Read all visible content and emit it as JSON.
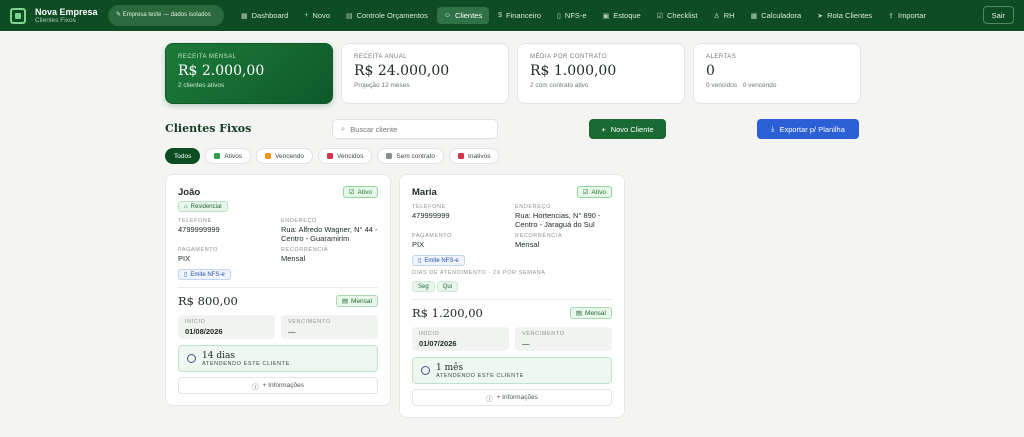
{
  "brand": {
    "name": "Nova Empresa",
    "sub": "Clientes Fixos"
  },
  "test_pill": "Empresa teste — dados isolados",
  "nav": [
    {
      "label": "Dashboard",
      "icon": "▦",
      "active": false
    },
    {
      "label": "Novo",
      "icon": "+",
      "active": false
    },
    {
      "label": "Controle Orçamentos",
      "icon": "▤",
      "active": false
    },
    {
      "label": "Clientes",
      "icon": "☺",
      "active": true
    },
    {
      "label": "Financeiro",
      "icon": "$",
      "active": false
    },
    {
      "label": "NFS-e",
      "icon": "▯",
      "active": false
    },
    {
      "label": "Estoque",
      "icon": "▣",
      "active": false
    },
    {
      "label": "Checklist",
      "icon": "☑",
      "active": false
    },
    {
      "label": "RH",
      "icon": "♙",
      "active": false
    },
    {
      "label": "Calculadora",
      "icon": "▦",
      "active": false
    },
    {
      "label": "Rota Clientes",
      "icon": "➤",
      "active": false
    },
    {
      "label": "Importar",
      "icon": "⇪",
      "active": false
    }
  ],
  "logout_label": "Sair",
  "stats": [
    {
      "label": "RECEITA MENSAL",
      "value": "R$ 2.000,00",
      "sub": "2 clientes ativos"
    },
    {
      "label": "RECEITA ANUAL",
      "value": "R$ 24.000,00",
      "sub": "Projeção 12 meses"
    },
    {
      "label": "MÉDIA POR CONTRATO",
      "value": "R$ 1.000,00",
      "sub": "2 com contrato ativo"
    },
    {
      "label": "ALERTAS",
      "value": "0",
      "sub": "0 vencidos · 0 vencendo"
    }
  ],
  "section_title": "Clientes Fixos",
  "search": {
    "placeholder": "Buscar cliente",
    "value": ""
  },
  "new_client_label": "Novo Cliente",
  "export_label": "Exportar p/ Planilha",
  "filters": [
    {
      "label": "Todos",
      "active": true,
      "dot_color": ""
    },
    {
      "label": "Ativos",
      "active": false,
      "dot_color": "#2e9e4c"
    },
    {
      "label": "Vencendo",
      "active": false,
      "dot_color": "#e59a1c"
    },
    {
      "label": "Vencidos",
      "active": false,
      "dot_color": "#d6364a"
    },
    {
      "label": "Sem contrato",
      "active": false,
      "dot_color": "#8a8f8b"
    },
    {
      "label": "Inativos",
      "active": false,
      "dot_color": "#d6364a"
    }
  ],
  "clients": [
    {
      "name": "João",
      "status": "Ativo",
      "type": "Residencial",
      "phone_label": "TELEFONE",
      "phone": "4799999999",
      "address_label": "ENDEREÇO",
      "address": "Rua: Alfredo Wagner, N° 44 - Centro - Guaramirim",
      "payment_label": "PAGAMENTO",
      "payment": "PIX",
      "recurrence_label": "RECORRÊNCIA",
      "recurrence": "Mensal",
      "nfse": "Emite NFS-e",
      "days_label": "",
      "days": [],
      "price": "R$ 800,00",
      "period": "Mensal",
      "start_label": "INÍCIO",
      "start": "01/08/2026",
      "due_label": "VENCIMENTO",
      "due": "—",
      "tenure": "14 dias",
      "tenure_sub": "ATENDENDO ESTE CLIENTE",
      "more": "+ Informações"
    },
    {
      "name": "Maria",
      "status": "Ativo",
      "type": "",
      "phone_label": "TELEFONE",
      "phone": "479999999",
      "address_label": "ENDEREÇO",
      "address": "Rua: Hortencias, N° 890 - Centro - Jaraguá do Sul",
      "payment_label": "PAGAMENTO",
      "payment": "PIX",
      "recurrence_label": "RECORRÊNCIA",
      "recurrence": "Mensal",
      "nfse": "Emite NFS-e",
      "days_label": "DIAS DE ATENDIMENTO · 2X POR SEMANA",
      "days": [
        "Seg",
        "Qui"
      ],
      "price": "R$ 1.200,00",
      "period": "Mensal",
      "start_label": "INÍCIO",
      "start": "01/07/2026",
      "due_label": "VENCIMENTO",
      "due": "—",
      "tenure": "1 mês",
      "tenure_sub": "ATENDENDO ESTE CLIENTE",
      "more": "+ Informações"
    }
  ]
}
